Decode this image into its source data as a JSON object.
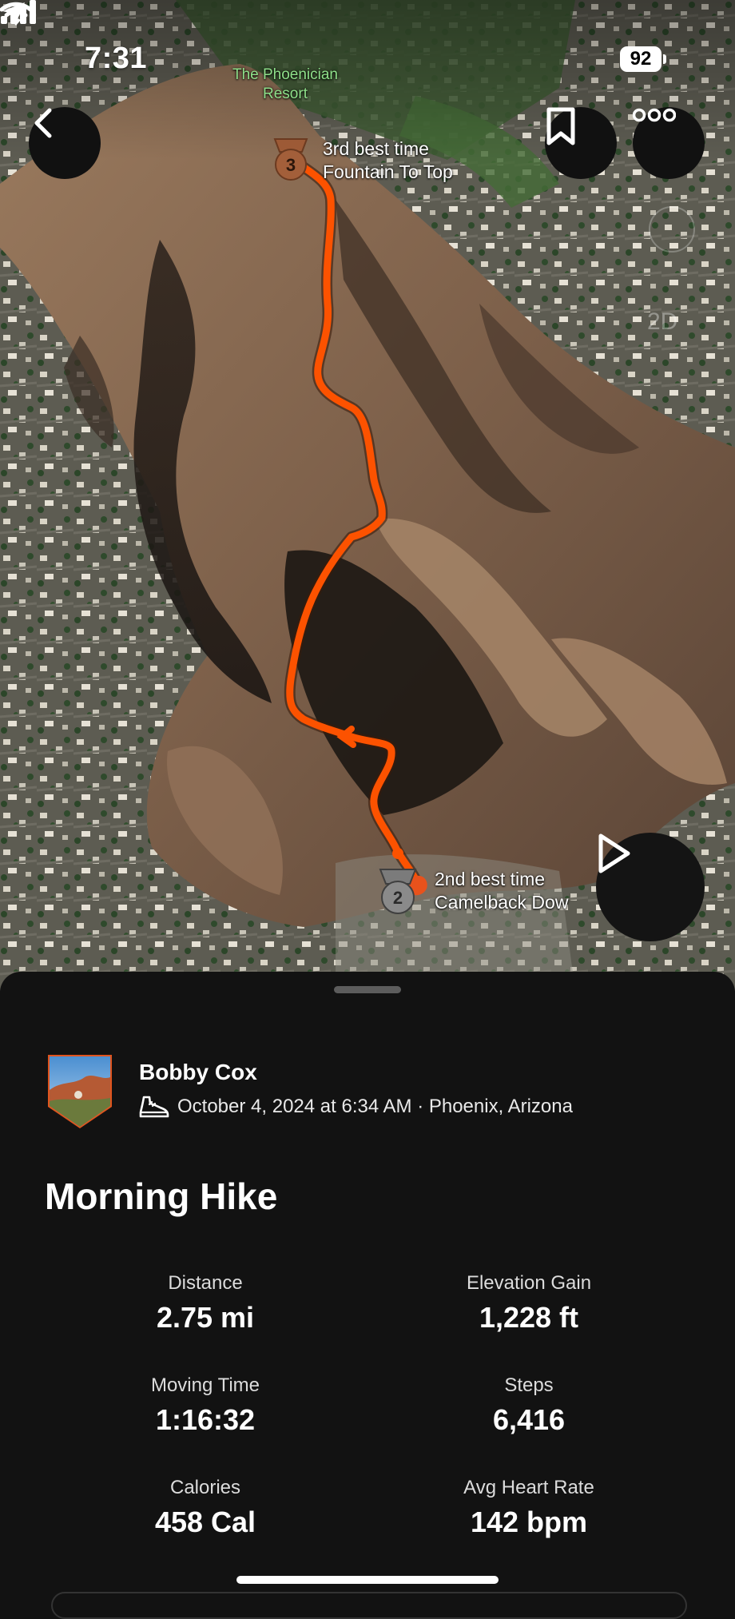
{
  "status_bar": {
    "time": "7:31",
    "battery": "92"
  },
  "map": {
    "place_label_line1": "The Phoenician",
    "place_label_line2": "Resort",
    "mode_label": "2D",
    "segment_top": {
      "medal": "3",
      "line1": "3rd best time",
      "line2": "Fountain To Top"
    },
    "segment_bottom": {
      "medal": "2",
      "line1": "2nd best time",
      "line2": "Camelback Dow"
    },
    "route_color": "#fc5200"
  },
  "icons": {
    "back": "chevron-left-icon",
    "bookmark": "bookmark-icon",
    "more": "more-dots-icon",
    "play": "play-icon",
    "shoe": "shoe-icon"
  },
  "activity": {
    "athlete_name": "Bobby Cox",
    "meta": "October 4, 2024 at 6:34 AM · Phoenix, Arizona",
    "title": "Morning Hike"
  },
  "stats": [
    {
      "label": "Distance",
      "value": "2.75 mi"
    },
    {
      "label": "Elevation Gain",
      "value": "1,228 ft"
    },
    {
      "label": "Moving Time",
      "value": "1:16:32"
    },
    {
      "label": "Steps",
      "value": "6,416"
    },
    {
      "label": "Calories",
      "value": "458 Cal"
    },
    {
      "label": "Avg Heart Rate",
      "value": "142 bpm"
    }
  ]
}
